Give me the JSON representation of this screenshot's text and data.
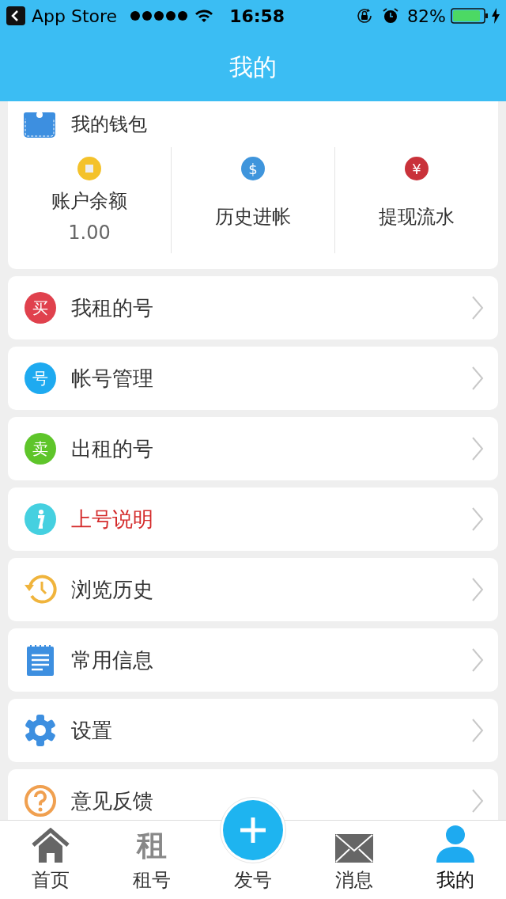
{
  "status_bar": {
    "back_label": "App Store",
    "time": "16:58",
    "battery": "82%"
  },
  "header": {
    "title": "我的"
  },
  "wallet": {
    "title": "我的钱包",
    "items": [
      {
        "kind": "coin",
        "color": "#f4c22b",
        "label": "账户余额",
        "value": "1.00"
      },
      {
        "kind": "char",
        "icon_text": "$",
        "color": "#3f95dc",
        "label": "历史进帐"
      },
      {
        "kind": "char",
        "icon_text": "¥",
        "color": "#c9323a",
        "label": "提现流水"
      }
    ]
  },
  "menu": [
    {
      "kind": "badge",
      "icon_text": "买",
      "color": "#e0414d",
      "label": "我租的号",
      "highlighted": false
    },
    {
      "kind": "badge",
      "icon_text": "号",
      "color": "#1eaaf0",
      "label": "帐号管理",
      "highlighted": false
    },
    {
      "kind": "badge",
      "icon_text": "卖",
      "color": "#5ec52a",
      "label": "出租的号",
      "highlighted": false
    },
    {
      "kind": "info",
      "color": "#45d0e0",
      "label": "上号说明",
      "highlighted": true
    },
    {
      "kind": "history",
      "color": "#f0b43c",
      "label": "浏览历史",
      "highlighted": false
    },
    {
      "kind": "note",
      "color": "#3d8fe0",
      "label": "常用信息",
      "highlighted": false
    },
    {
      "kind": "gear",
      "color": "#3d8fe0",
      "label": "设置",
      "highlighted": false
    },
    {
      "kind": "help",
      "color": "#f0a050",
      "label": "意见反馈",
      "highlighted": false
    }
  ],
  "tab_bar": [
    {
      "kind": "home",
      "label": "首页",
      "selected": false
    },
    {
      "kind": "char",
      "icon_text": "租",
      "label": "租号",
      "selected": false
    },
    {
      "kind": "plus",
      "label": "发号",
      "selected": false
    },
    {
      "kind": "mail",
      "label": "消息",
      "selected": false
    },
    {
      "kind": "person",
      "label": "我的",
      "selected": true
    }
  ]
}
